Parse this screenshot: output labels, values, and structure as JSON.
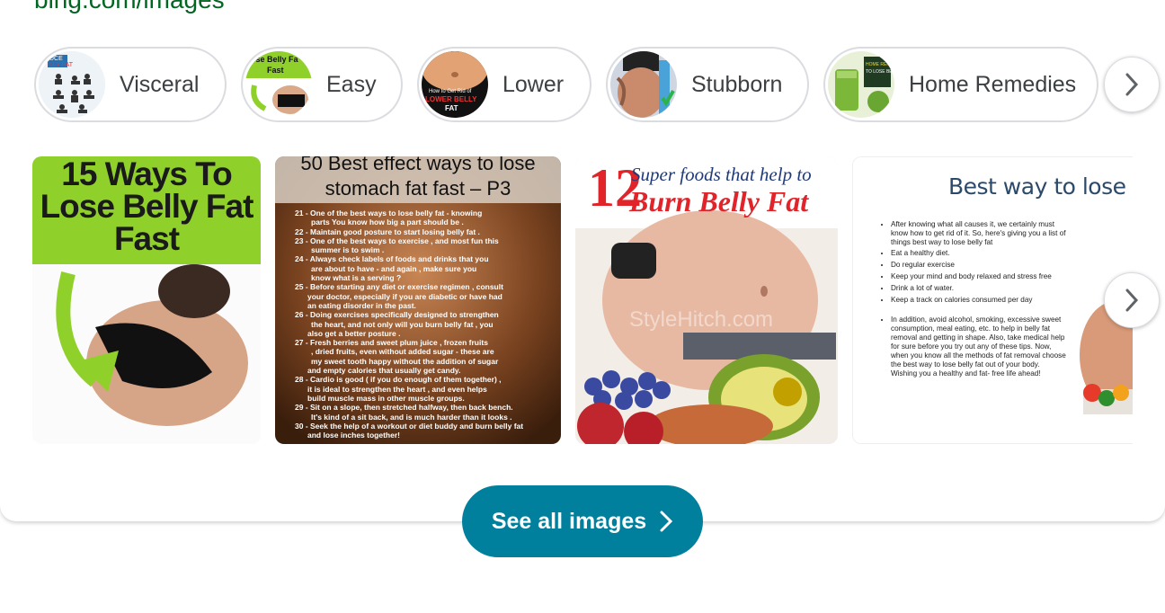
{
  "header": {
    "source_url": "bing.com/images"
  },
  "pills": [
    {
      "label": "Visceral",
      "thumb_text": "UCE / LLY FAT"
    },
    {
      "label": "Easy",
      "thumb_text": "ose Belly Fa / Fast"
    },
    {
      "label": "Lower",
      "thumb_text": "How to Get Rid of / LOWER BELLY FAT"
    },
    {
      "label": "Stubborn"
    },
    {
      "label": "Home Remedies",
      "thumb_text": "HOME REMEDIES TO LOSE BELLY"
    }
  ],
  "images": [
    {
      "title": "15 Ways To Lose Belly Fat Fast"
    },
    {
      "title": "50 Best effect ways to lose stomach fat fast – P3",
      "lines": [
        "21 - One of the best ways to lose belly fat - knowing",
        "parts You know how big a part should be .",
        "22 - Maintain good posture to start losing belly fat .",
        "23 - One of the best ways to exercise , and most fun this",
        "summer is to swim .",
        "24 - Always check labels of foods and drinks that you",
        "are about to have - and again , make sure you",
        "know what is a serving ?",
        "25 - Before starting any diet or exercise regimen , consult",
        "your doctor, especially if you are diabetic or have had",
        "an eating disorder in the past.",
        "26 - Doing exercises specifically designed to strengthen",
        "the heart, and not only will you burn belly fat , you",
        "also get a better posture .",
        "27 - Fresh berries and sweet plum juice , frozen fruits",
        ", dried fruits, even without added sugar - these are",
        "my sweet tooth happy without the addition of sugar",
        "and empty calories that usually get candy.",
        "28 - Cardio is good ( if you do enough of them together) ,",
        "it is ideal to strengthen the heart , and even helps",
        "build muscle mass in other muscle groups.",
        "29 - Sit on a slope, then stretched halfway, then back bench.",
        "It's kind of a sit back, and is much harder than it looks .",
        "30 - Seek the help of a workout or diet buddy and burn belly fat",
        "and lose inches together!"
      ]
    },
    {
      "number": "12",
      "title_a": "Super foods that help to",
      "title_b": "Burn Belly Fat",
      "watermark": "StyleHitch.com"
    },
    {
      "title": "Best way to lose belly",
      "bullets": [
        "After knowing what all causes it, we certainly must know how to get rid of it. So, here's giving you a list of things best way to lose belly fat",
        "Eat a healthy diet.",
        "Do regular exercise",
        "Keep your mind and body relaxed and stress free",
        "Drink a lot of water.",
        "Keep a track on calories consumed per day"
      ],
      "paragraph": "In addition, avoid alcohol, smoking, excessive sweet consumption, meal eating, etc. to help in belly fat removal and getting in shape. Also, take medical help for sure before you try out any of these tips. Now, when you know all the methods of fat removal choose the best way to lose belly fat out of your body. Wishing you a healthy and fat- free life ahead!"
    }
  ],
  "see_all": {
    "label": "See all images"
  },
  "icons": {
    "next": "chevron-right-icon"
  },
  "colors": {
    "accent": "#00809d",
    "url": "#006621",
    "pill_border": "#dadce0"
  }
}
